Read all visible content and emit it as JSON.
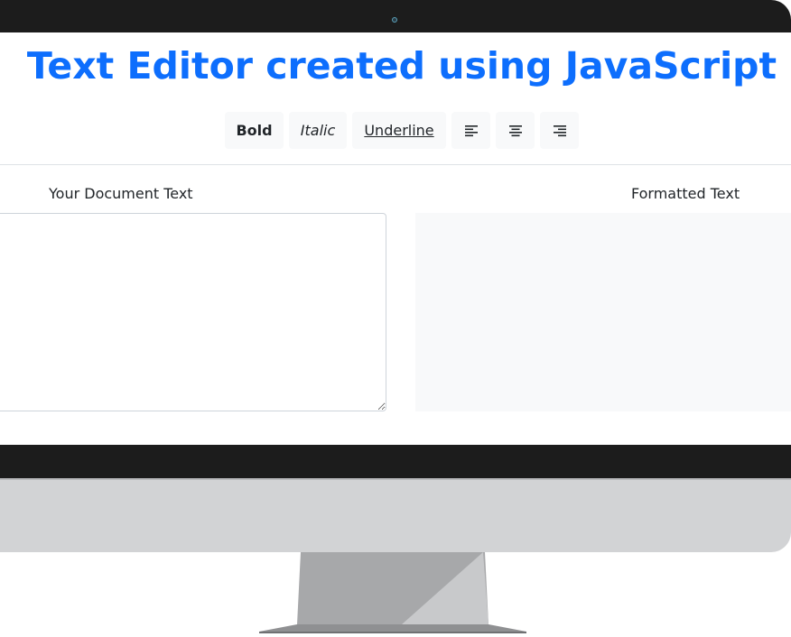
{
  "page": {
    "title": "Text Editor created using JavaScript"
  },
  "toolbar": {
    "bold_label": "Bold",
    "italic_label": "Italic",
    "underline_label": "Underline",
    "align_left_icon": "align-left-icon",
    "align_center_icon": "align-center-icon",
    "align_right_icon": "align-right-icon"
  },
  "editor": {
    "input_label": "Your Document Text",
    "input_value": "",
    "output_label": "Formatted Text",
    "output_value": ""
  },
  "colors": {
    "title_blue": "#0d6efd",
    "button_bg": "#f8f9fa",
    "bezel": "#1c1c1c",
    "chin": "#d2d3d5",
    "output_bg": "#f8f9fa"
  }
}
